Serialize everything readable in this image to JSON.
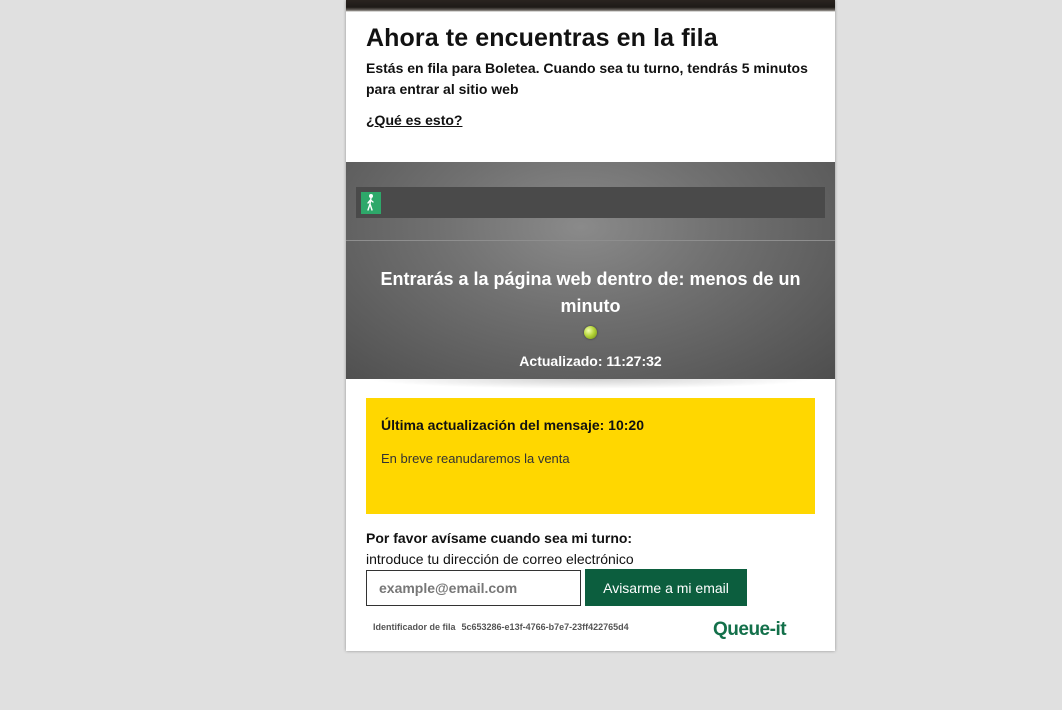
{
  "header": {
    "title": "Ahora te encuentras en la fila",
    "subtitle": "Estás en fila para Boletea. Cuando sea tu turno, tendrás 5 minutos para entrar al sitio web",
    "what_is_this_link": "¿Qué es esto?"
  },
  "queue": {
    "progress": 0.0,
    "progress_icon": "walking-person-icon",
    "eta_text": "Entrarás a la página web dentro de: menos de un minuto",
    "status_indicator_icon": "green-dot-icon",
    "updated_text": "Actualizado: 11:27:32"
  },
  "notice": {
    "title": "Última actualización del mensaje: 10:20",
    "body": "En breve reanudaremos la venta",
    "background_color": "#ffd700"
  },
  "notify": {
    "heading": "Por favor avísame cuando sea mi turno:",
    "subheading": "introduce tu dirección de correo electrónico",
    "email_value": "",
    "email_placeholder": "example@email.com",
    "button_label": "Avisarme a mi email",
    "button_color": "#0c5e3e"
  },
  "footer": {
    "queue_id_label": "Identificador de fila",
    "queue_id_value": "5c653286-e13f-4766-b7e7-23ff422765d4",
    "logo_text": "Queue-it",
    "logo_color": "#13704a"
  }
}
